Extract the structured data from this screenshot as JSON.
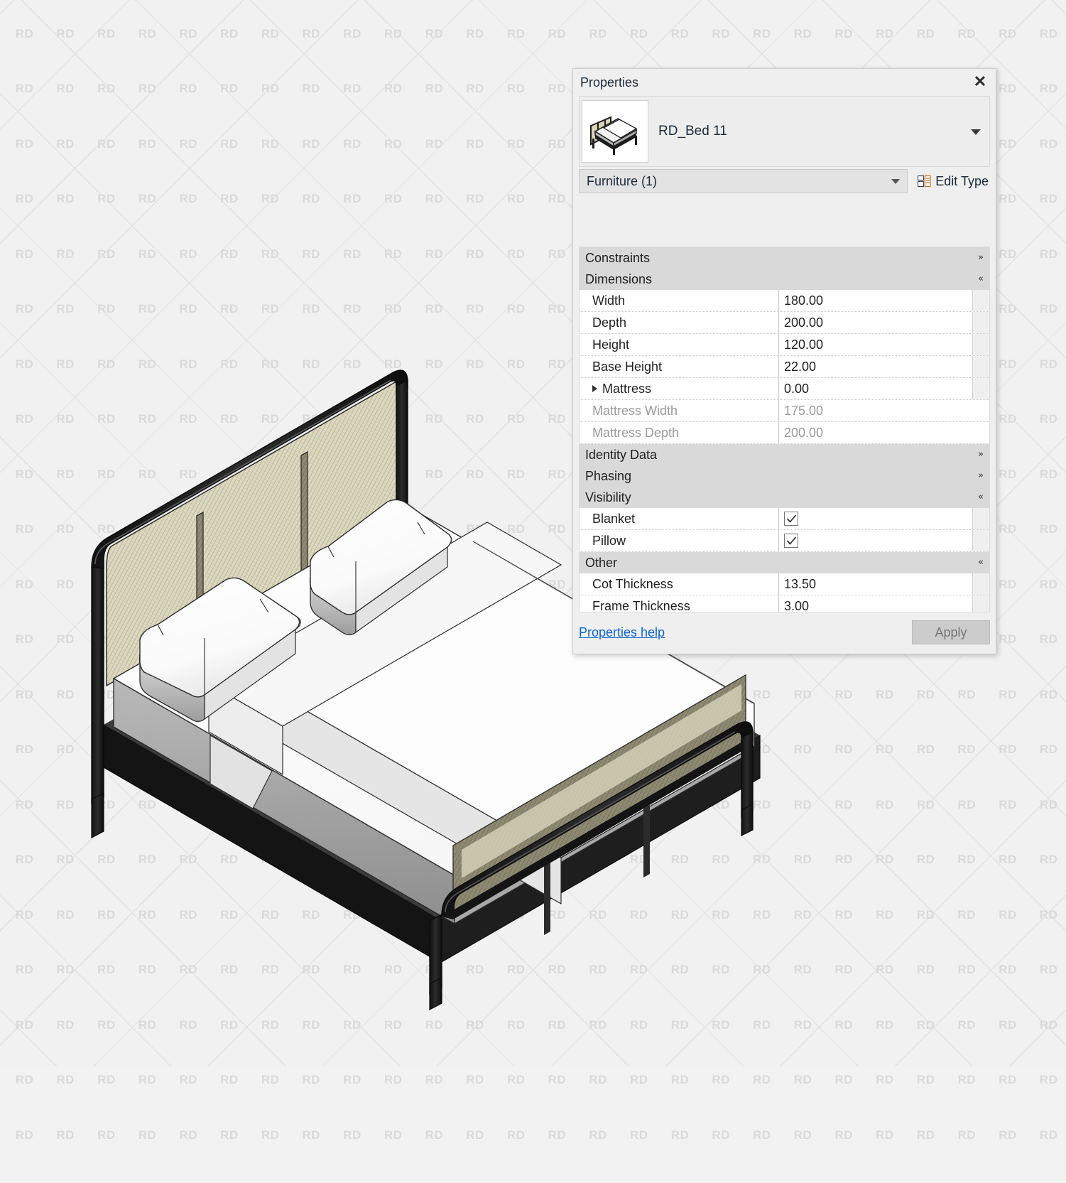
{
  "panel": {
    "title": "Properties",
    "close_icon": "close-icon",
    "type_name": "RD_Bed 11",
    "category": "Furniture (1)",
    "edit_type_label": "Edit Type",
    "properties_help": "Properties help",
    "apply_label": "Apply",
    "groups": [
      {
        "name": "Constraints",
        "chevron": "»",
        "collapsed": true,
        "rows": []
      },
      {
        "name": "Dimensions",
        "chevron": "«",
        "collapsed": false,
        "rows": [
          {
            "label": "Width",
            "value": "180.00",
            "type": "text",
            "disabled": false,
            "expandable": false,
            "lock": true
          },
          {
            "label": "Depth",
            "value": "200.00",
            "type": "text",
            "disabled": false,
            "expandable": false,
            "lock": true
          },
          {
            "label": "Height",
            "value": "120.00",
            "type": "text",
            "disabled": false,
            "expandable": false,
            "lock": true
          },
          {
            "label": "Base Height",
            "value": "22.00",
            "type": "text",
            "disabled": false,
            "expandable": false,
            "lock": true
          },
          {
            "label": "Mattress",
            "value": "0.00",
            "type": "text",
            "disabled": false,
            "expandable": true,
            "lock": true
          },
          {
            "label": "Mattress Width",
            "value": "175.00",
            "type": "text",
            "disabled": true,
            "expandable": false,
            "lock": false
          },
          {
            "label": "Mattress Depth",
            "value": "200.00",
            "type": "text",
            "disabled": true,
            "expandable": false,
            "lock": false
          }
        ]
      },
      {
        "name": "Identity Data",
        "chevron": "»",
        "collapsed": true,
        "rows": []
      },
      {
        "name": "Phasing",
        "chevron": "»",
        "collapsed": true,
        "rows": []
      },
      {
        "name": "Visibility",
        "chevron": "«",
        "collapsed": false,
        "rows": [
          {
            "label": "Blanket",
            "value": "checked",
            "type": "checkbox",
            "disabled": false,
            "expandable": false,
            "lock": true
          },
          {
            "label": "Pillow",
            "value": "checked",
            "type": "checkbox",
            "disabled": false,
            "expandable": false,
            "lock": true
          }
        ]
      },
      {
        "name": "Other",
        "chevron": "«",
        "collapsed": false,
        "rows": [
          {
            "label": "Cot Thickness",
            "value": "13.50",
            "type": "text",
            "disabled": false,
            "expandable": false,
            "lock": true
          },
          {
            "label": "Frame Thickness",
            "value": "3.00",
            "type": "text",
            "disabled": false,
            "expandable": false,
            "lock": true
          }
        ]
      }
    ]
  },
  "watermark": {
    "text": "RD",
    "color": "#dadada"
  },
  "viewport": {
    "model_name": "RD_Bed 11",
    "colors": {
      "frame": "#1c1c1c",
      "rattan": "#ddd9c0",
      "rattan_shadow": "#8a8570",
      "mattress": "#ffffff",
      "mattress_side": "#8c8c8c",
      "blanket": "#fbfbfb",
      "pillow": "#fdfdfd",
      "background": "#f1f1f1"
    }
  }
}
